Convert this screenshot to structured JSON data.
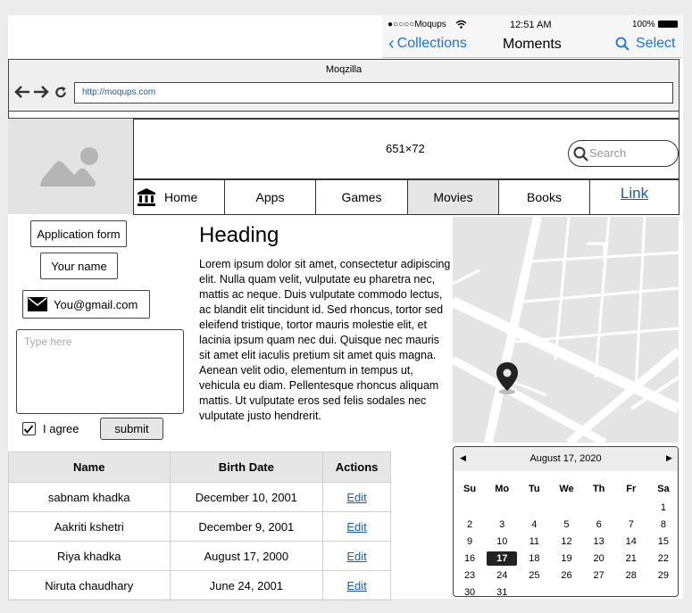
{
  "ios": {
    "carrier": "●○○○○Moqups",
    "time": "12:51 AM",
    "battery": "100%",
    "back_label": "Collections",
    "title": "Moments",
    "action_label": "Select"
  },
  "browser": {
    "title": "Moqzilla",
    "url": "http://moqups.com"
  },
  "header": {
    "banner_text": "651×72",
    "search_placeholder": "Search"
  },
  "nav": {
    "items": [
      {
        "label": "Home"
      },
      {
        "label": "Apps"
      },
      {
        "label": "Games"
      },
      {
        "label": "Movies"
      },
      {
        "label": "Books"
      },
      {
        "label": "Link"
      }
    ]
  },
  "form": {
    "title": "Application form",
    "name_label": "Your name",
    "email_value": "You@gmail.com",
    "textarea_placeholder": "Type here",
    "agree_label": "I agree",
    "submit_label": "submit"
  },
  "content": {
    "heading": "Heading",
    "paragraph": "Lorem ipsum dolor sit amet, consectetur adipiscing elit. Nulla quam velit, vulputate eu pharetra nec, mattis ac neque. Duis vulputate commodo lectus, ac blandit elit tincidunt id. Sed rhoncus, tortor sed eleifend tristique, tortor mauris molestie elit, et lacinia ipsum quam nec dui. Quisque nec mauris sit amet elit iaculis pretium sit amet quis magna. Aenean velit odio, elementum in tempus ut, vehicula eu diam. Pellentesque rhoncus aliquam mattis. Ut vulputate eros sed felis sodales nec vulputate justo hendrerit."
  },
  "table": {
    "headers": [
      "Name",
      "Birth Date",
      "Actions"
    ],
    "rows": [
      {
        "name": "sabnam khadka",
        "date": "December 10, 2001",
        "action": "Edit"
      },
      {
        "name": "Aakriti kshetri",
        "date": "December 9, 2001",
        "action": "Edit"
      },
      {
        "name": "Riya khadka",
        "date": "August 17, 2000",
        "action": "Edit"
      },
      {
        "name": "Niruta chaudhary",
        "date": "June 24, 2001",
        "action": "Edit"
      }
    ]
  },
  "calendar": {
    "month_label": "August 17, 2020",
    "weekdays": [
      "Su",
      "Mo",
      "Tu",
      "We",
      "Th",
      "Fr",
      "Sa"
    ],
    "weeks": [
      [
        "",
        "",
        "",
        "",
        "",
        "",
        "1"
      ],
      [
        "2",
        "3",
        "4",
        "5",
        "6",
        "7",
        "8"
      ],
      [
        "9",
        "10",
        "11",
        "12",
        "13",
        "14",
        "15"
      ],
      [
        "16",
        "17",
        "18",
        "19",
        "20",
        "21",
        "22"
      ],
      [
        "23",
        "24",
        "25",
        "26",
        "27",
        "28",
        "29"
      ],
      [
        "30",
        "31",
        "",
        "",
        "",
        "",
        ""
      ]
    ],
    "selected_day": "17"
  }
}
